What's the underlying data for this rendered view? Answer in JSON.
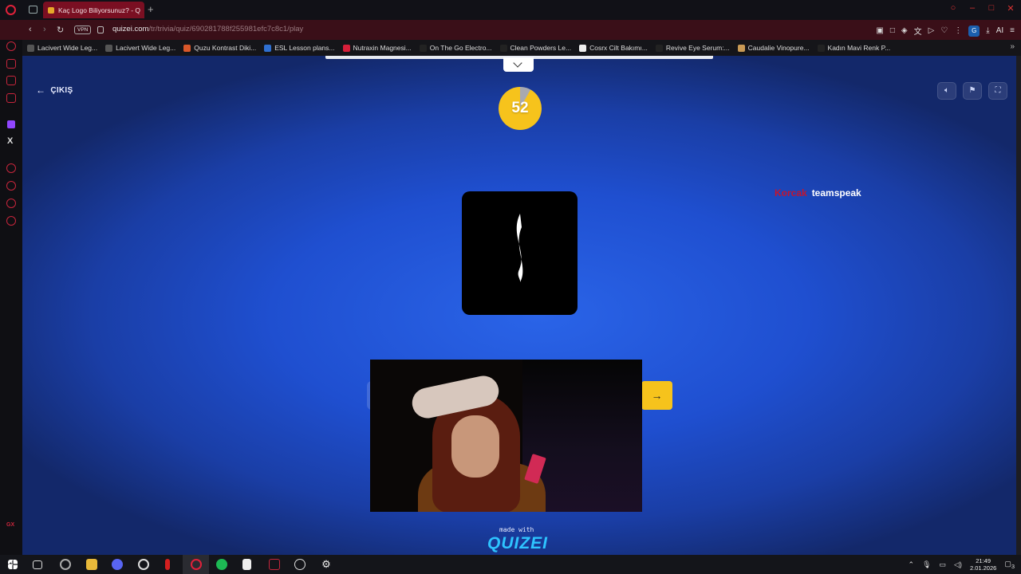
{
  "browser": {
    "tab_title": "Kaç Logo Biliyorsunuz? - Q",
    "url_host": "quizei.com",
    "url_path": "/tr/trivia/quiz/690281788f255981efc7c8c1/play",
    "vpn_label": "VPN",
    "profile_initial": "G",
    "ai_label": "AI"
  },
  "bookmarks": [
    {
      "label": "Lacivert Wide Leg...",
      "icon_color": "#555"
    },
    {
      "label": "Lacivert Wide Leg...",
      "icon_color": "#555"
    },
    {
      "label": "Quzu Kontrast Diki...",
      "icon_color": "#d9572a"
    },
    {
      "label": "ESL Lesson plans...",
      "icon_color": "#2f6fd0"
    },
    {
      "label": "Nutraxin Magnesi...",
      "icon_color": "#d61f3a"
    },
    {
      "label": "On The Go Electro...",
      "icon_color": "#222"
    },
    {
      "label": "Clean Powders Le...",
      "icon_color": "#222"
    },
    {
      "label": "Cosrx Cilt Bakımı...",
      "icon_color": "#eee"
    },
    {
      "label": "Revive Eye Serum:...",
      "icon_color": "#222"
    },
    {
      "label": "Caudalie Vinopure...",
      "icon_color": "#c99a55"
    },
    {
      "label": "Kadın Mavi Renk P...",
      "icon_color": "#222"
    }
  ],
  "quiz": {
    "exit_label": "ÇIKIŞ",
    "timer": "52",
    "timer_remaining_fraction": 0.92,
    "chat_user": "Korcak",
    "chat_text": "teamspeak",
    "next_arrow": "→",
    "made_with": "made with",
    "brand": "QUIZEI"
  },
  "taskbar": {
    "time": "21:49",
    "date": "2.01.2026",
    "notifications": "3"
  },
  "colors": {
    "accent_yellow": "#f6c31c",
    "opera_red": "#c8263c",
    "chat_user": "#c21530",
    "brand": "#2ec4ff"
  }
}
